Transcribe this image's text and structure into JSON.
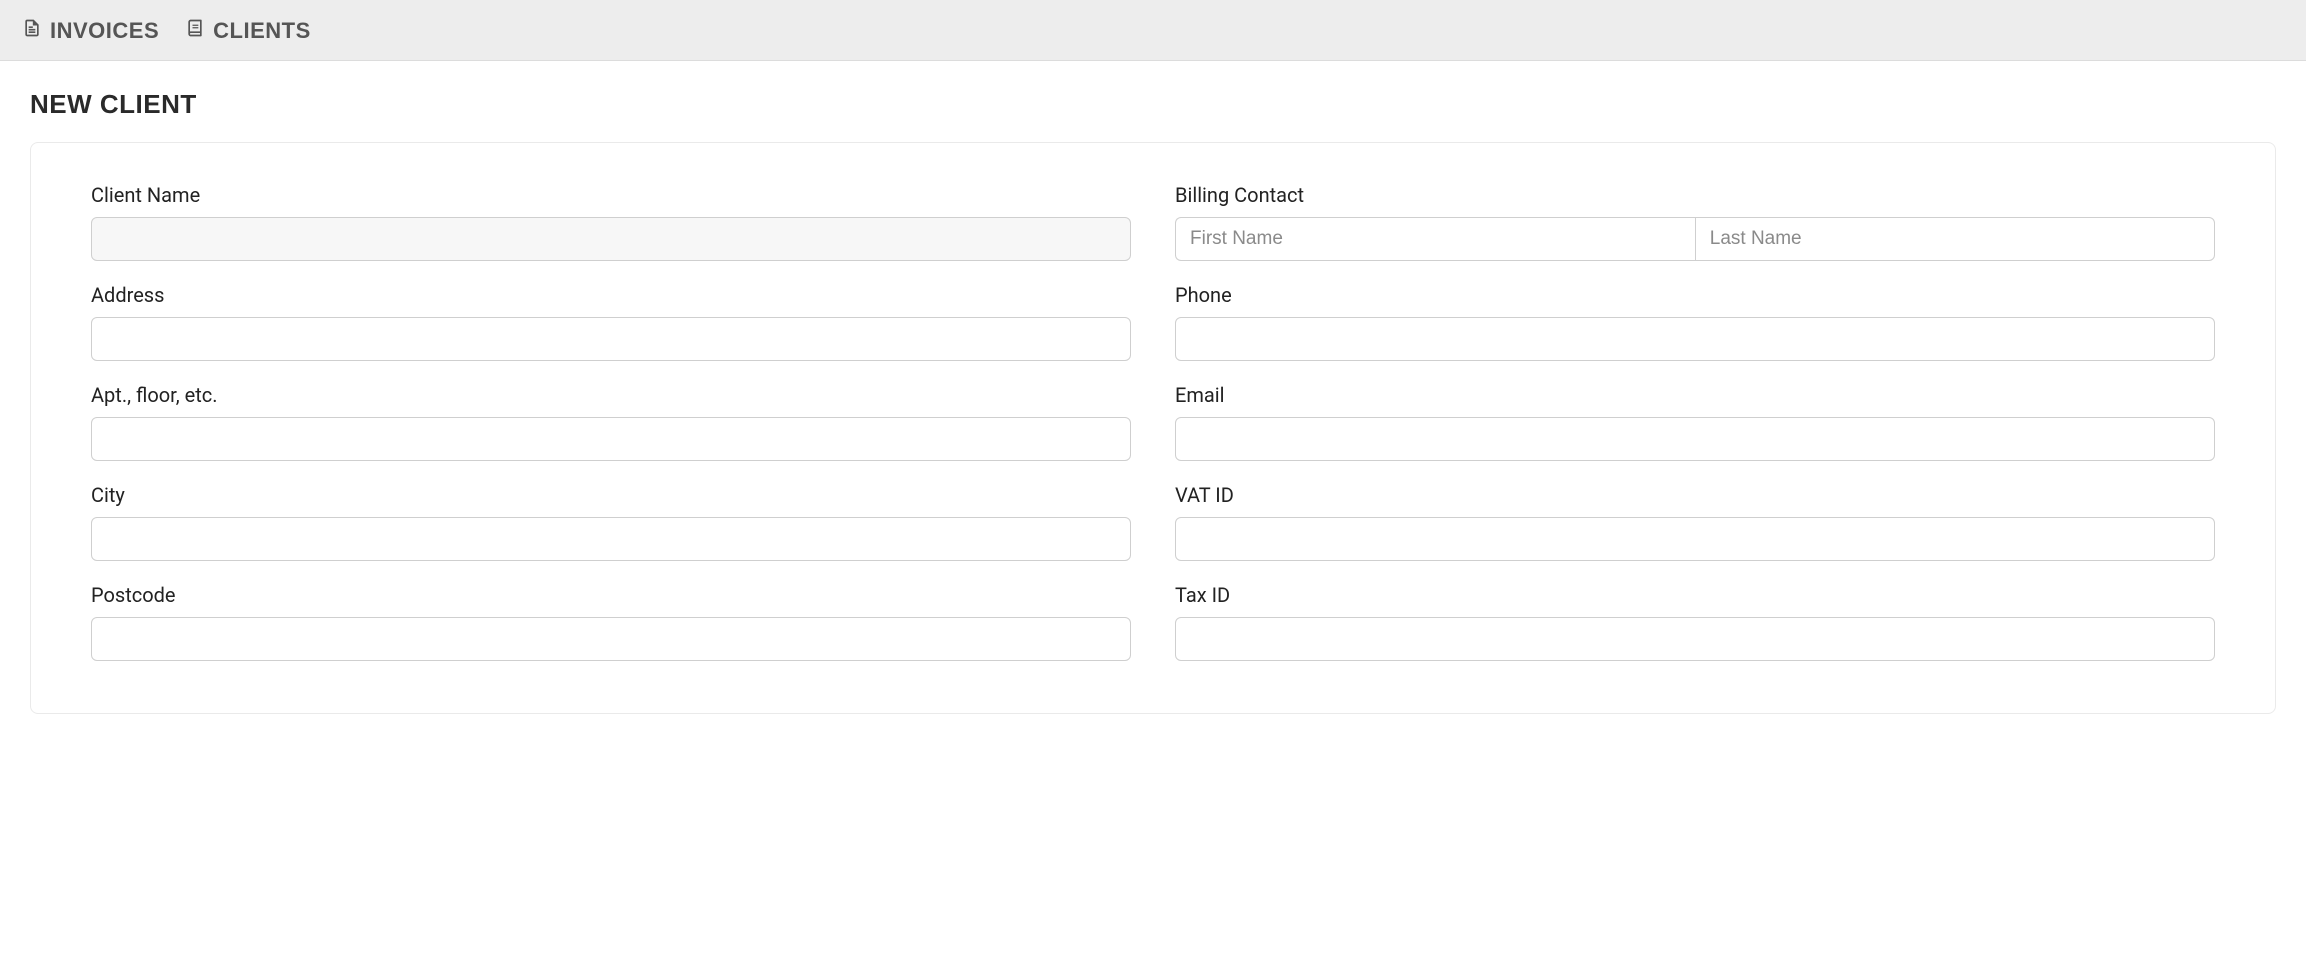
{
  "nav": {
    "invoices": "INVOICES",
    "clients": "CLIENTS"
  },
  "page": {
    "title": "NEW CLIENT"
  },
  "form": {
    "left": {
      "client_name_label": "Client Name",
      "address_label": "Address",
      "apt_label": "Apt., floor, etc.",
      "city_label": "City",
      "postcode_label": "Postcode"
    },
    "right": {
      "billing_contact_label": "Billing Contact",
      "first_name_placeholder": "First Name",
      "last_name_placeholder": "Last Name",
      "phone_label": "Phone",
      "email_label": "Email",
      "vat_id_label": "VAT ID",
      "tax_id_label": "Tax ID"
    }
  }
}
